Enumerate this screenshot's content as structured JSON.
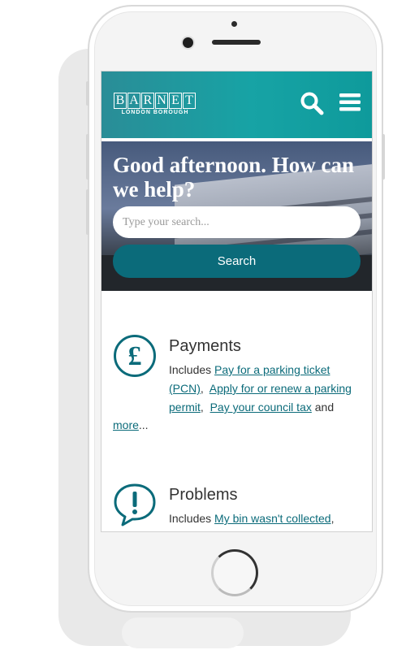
{
  "header": {
    "logo_text": "BARNET",
    "logo_subtext": "LONDON BOROUGH",
    "search_icon": "search-icon",
    "menu_icon": "hamburger-menu-icon"
  },
  "hero": {
    "greeting": "Good afternoon. How can we help?",
    "search_placeholder": "Type your search...",
    "search_button": "Search"
  },
  "sections": [
    {
      "icon": "pound-icon",
      "title": "Payments",
      "prefix": "Includes ",
      "links": [
        "Pay for a parking ticket (PCN)",
        "Apply for or renew a parking permit",
        "Pay your council tax"
      ],
      "and_text": " and",
      "more_link": "more",
      "ellipsis": "..."
    },
    {
      "icon": "exclamation-speech-icon",
      "title": "Problems",
      "prefix": "Includes ",
      "links": [
        "My bin wasn't collected"
      ],
      "suffix": ","
    }
  ],
  "colors": {
    "accent": "#0b6b7a",
    "header_start": "#2a8d97",
    "header_end": "#0e9a9b"
  }
}
